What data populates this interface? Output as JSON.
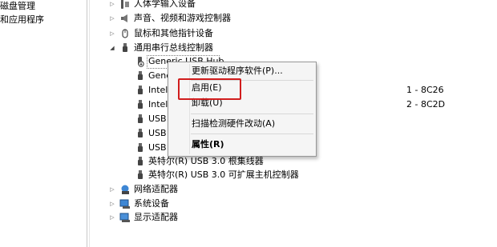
{
  "nav": {
    "items": [
      "磁盘管理",
      "和应用程序"
    ]
  },
  "tree": {
    "categories": {
      "hid": "人体学输入设备",
      "sound": "声音、视频和游戏控制器",
      "mouse": "鼠标和其他指针设备",
      "usb": "通用串行总线控制器",
      "network": "网络适配器",
      "system": "系统设备",
      "display": "显示适配器"
    },
    "usb_children": [
      {
        "text": "Generic USB Hub",
        "suffix": ""
      },
      {
        "text": "Gene",
        "suffix": ""
      },
      {
        "text": "Intel",
        "suffix": "1 - 8C26"
      },
      {
        "text": "Intel",
        "suffix": "2 - 8C2D"
      },
      {
        "text": "USB",
        "suffix": ""
      },
      {
        "text": "USB",
        "suffix": ""
      },
      {
        "text": "USB",
        "suffix": ""
      },
      {
        "text": "英特尔(R) USB 3.0 根集线器",
        "suffix": ""
      },
      {
        "text": "英特尔(R) USB 3.0 可扩展主机控制器",
        "suffix": ""
      }
    ]
  },
  "context_menu": {
    "update_driver": "更新驱动程序软件(P)...",
    "enable": "启用(E)",
    "uninstall": "卸载(U)",
    "scan": "扫描检测硬件改动(A)",
    "properties": "属性(R)"
  },
  "colors": {
    "highlight_border": "#d11d1d",
    "menu_bg": "#f5f5f5"
  }
}
